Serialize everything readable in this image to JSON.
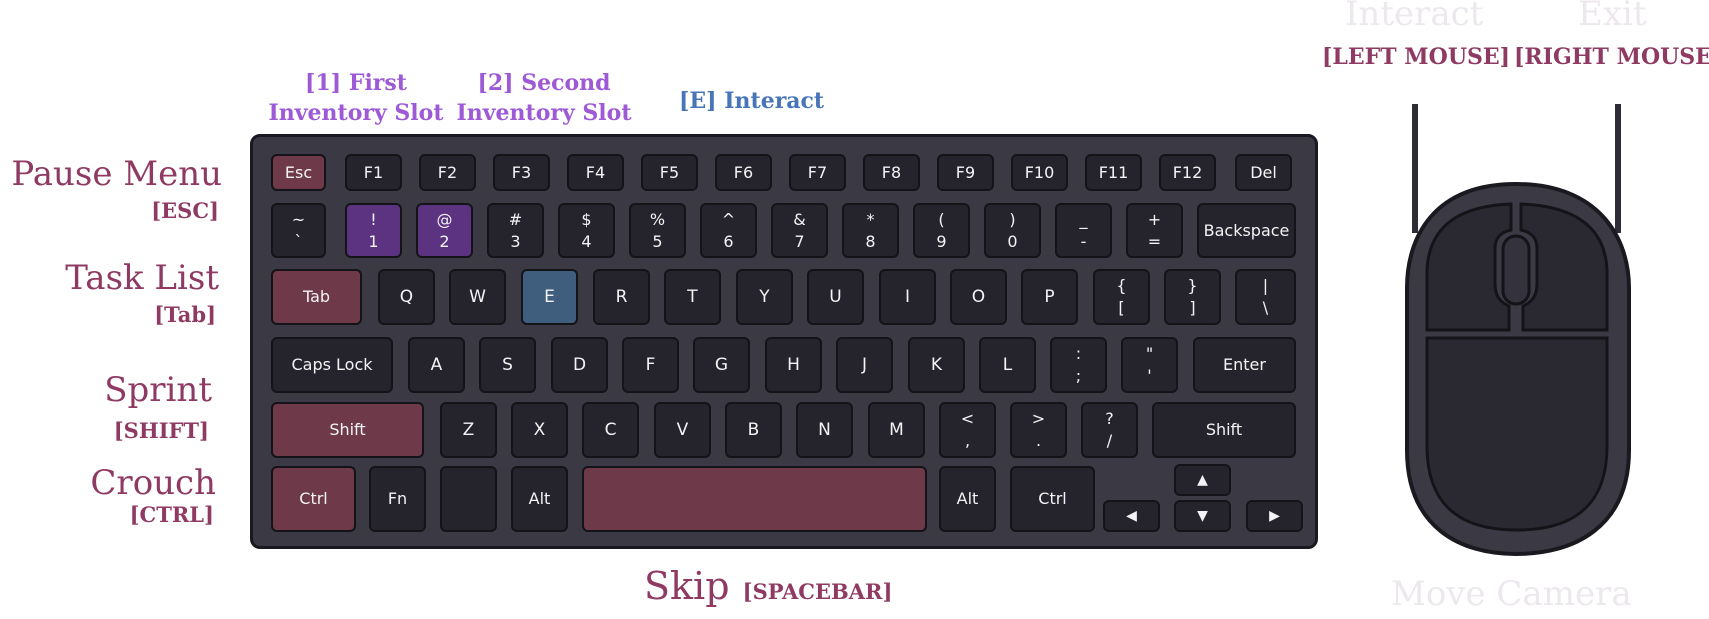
{
  "left_labels": {
    "pause_title": "Pause Menu",
    "pause_key": "[ESC]",
    "task_title": "Task List",
    "task_key": "[Tab]",
    "sprint_title": "Sprint",
    "sprint_key": "[SHIFT]",
    "crouch_title": "Crouch",
    "crouch_key": "[CTRL]"
  },
  "top_labels": {
    "slot1_line1": "[1] First",
    "slot1_line2": "Inventory Slot",
    "slot2_line1": "[2] Second",
    "slot2_line2": "Inventory Slot",
    "interact": "[E] Interact"
  },
  "bottom_labels": {
    "skip_title": "Skip",
    "skip_key": "[SPACEBAR]"
  },
  "mouse_labels": {
    "left_title": "Interact",
    "left_key": "[LEFT MOUSE]",
    "right_title": "Exit",
    "right_key": "[RIGHT MOUSE]",
    "move": "Move Camera"
  },
  "keys": {
    "esc": "Esc",
    "f1": "F1",
    "f2": "F2",
    "f3": "F3",
    "f4": "F4",
    "f5": "F5",
    "f6": "F6",
    "f7": "F7",
    "f8": "F8",
    "f9": "F9",
    "f10": "F10",
    "f11": "F11",
    "f12": "F12",
    "del": "Del",
    "tilde_top": "~",
    "tilde_bot": "`",
    "d1_top": "!",
    "d1_bot": "1",
    "d2_top": "@",
    "d2_bot": "2",
    "d3_top": "#",
    "d3_bot": "3",
    "d4_top": "$",
    "d4_bot": "4",
    "d5_top": "%",
    "d5_bot": "5",
    "d6_top": "^",
    "d6_bot": "6",
    "d7_top": "&",
    "d7_bot": "7",
    "d8_top": "*",
    "d8_bot": "8",
    "d9_top": "(",
    "d9_bot": "9",
    "d0_top": ")",
    "d0_bot": "0",
    "minus_top": "_",
    "minus_bot": "-",
    "eq_top": "+",
    "eq_bot": "=",
    "backspace": "Backspace",
    "tab": "Tab",
    "q": "Q",
    "w": "W",
    "e": "E",
    "r": "R",
    "t": "T",
    "y": "Y",
    "u": "U",
    "i": "I",
    "o": "O",
    "p": "P",
    "lbr_top": "{",
    "lbr_bot": "[",
    "rbr_top": "}",
    "rbr_bot": "]",
    "bs_top": "|",
    "bs_bot": "\\",
    "caps": "Caps Lock",
    "a": "A",
    "s": "S",
    "d": "D",
    "f": "F",
    "g": "G",
    "h": "H",
    "j": "J",
    "k": "K",
    "l": "L",
    "semi_top": ":",
    "semi_bot": ";",
    "quote_top": "\"",
    "quote_bot": "'",
    "enter": "Enter",
    "lshift": "Shift",
    "z": "Z",
    "x": "X",
    "c": "C",
    "v": "V",
    "b": "B",
    "n": "N",
    "m": "M",
    "comma_top": "<",
    "comma_bot": ",",
    "period_top": ">",
    "period_bot": ".",
    "slash_top": "?",
    "slash_bot": "/",
    "rshift": "Shift",
    "lctrl": "Ctrl",
    "fn": "Fn",
    "lalt": "Alt",
    "ralt": "Alt",
    "rctrl": "Ctrl",
    "up": "▲",
    "left": "◀",
    "down": "▼",
    "right": "▶"
  },
  "colors": {
    "label_maroon": "#8e3a63",
    "label_purple": "#9d59d6",
    "label_blue": "#4775b8",
    "key_highlight_red": "#6e3a4a",
    "key_highlight_purple": "#5b3380",
    "key_highlight_blue": "#3f5d7d",
    "keyboard_body": "#3b3944",
    "key_face": "#25242c"
  }
}
